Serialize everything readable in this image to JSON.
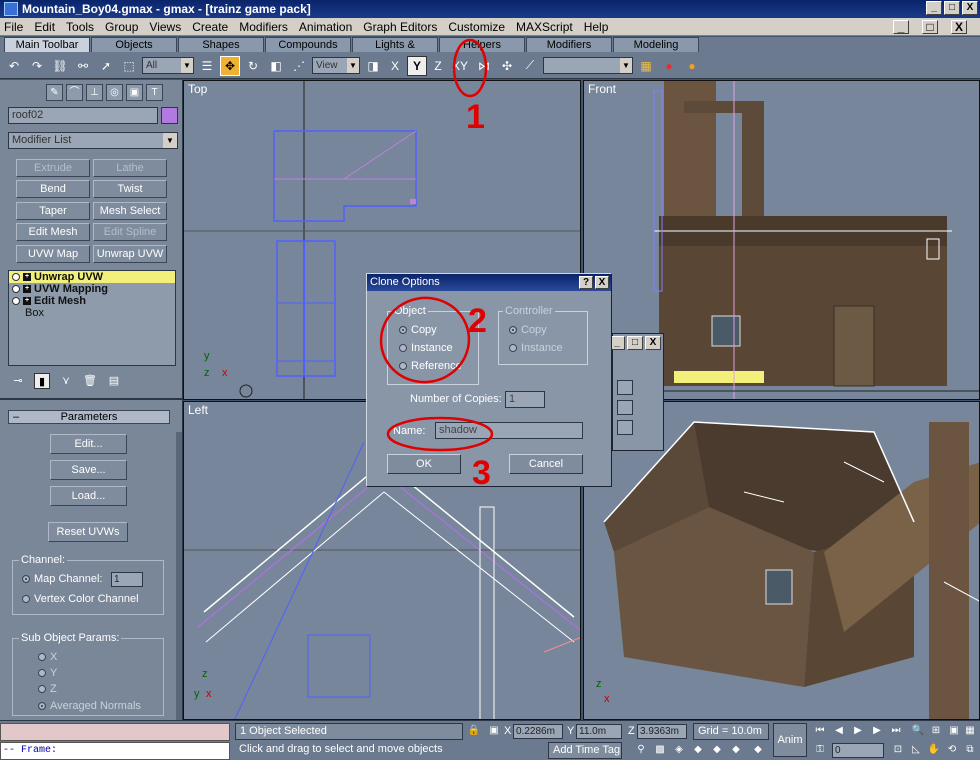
{
  "window": {
    "title": "Mountain_Boy04.gmax - gmax - [trainz game pack]",
    "min": "_",
    "max": "□",
    "close": "X"
  },
  "menu": [
    "File",
    "Edit",
    "Tools",
    "Group",
    "Views",
    "Create",
    "Modifiers",
    "Animation",
    "Graph Editors",
    "Customize",
    "MAXScript",
    "Help"
  ],
  "tabs": [
    "Main Toolbar",
    "Objects",
    "Shapes",
    "Compounds",
    "Lights & Cameras",
    "Helpers",
    "Modifiers",
    "Modeling"
  ],
  "toolbar": {
    "filter": "All",
    "refcoord": "View"
  },
  "left": {
    "object_name": "roof02",
    "modifier_list": "Modifier List",
    "mod_buttons": [
      "Extrude",
      "Lathe",
      "Bend",
      "Twist",
      "Taper",
      "Mesh Select",
      "Edit Mesh",
      "Edit Spline",
      "UVW Map",
      "Unwrap UVW"
    ],
    "stack": [
      "Unwrap UVW",
      "UVW Mapping",
      "Edit Mesh",
      "Box"
    ],
    "params_title": "Parameters",
    "params_buttons": [
      "Edit...",
      "Save...",
      "Load...",
      "Reset UVWs"
    ],
    "channel_label": "Channel:",
    "map_channel": "Map Channel:",
    "map_channel_val": "1",
    "vertex_color": "Vertex Color Channel",
    "subobj_label": "Sub Object Params:",
    "sub_x": "X",
    "sub_y": "Y",
    "sub_z": "Z",
    "avg_normals": "Averaged Normals"
  },
  "viewports": {
    "top": "Top",
    "front": "Front",
    "left": "Left"
  },
  "dialog": {
    "title": "Clone Options",
    "help": "?",
    "close": "X",
    "object_group": "Object",
    "copy": "Copy",
    "instance": "Instance",
    "reference": "Reference",
    "controller_group": "Controller",
    "c_copy": "Copy",
    "c_instance": "Instance",
    "num_copies_label": "Number of Copies:",
    "num_copies": "1",
    "name_label": "Name:",
    "name_value": "shadow",
    "ok": "OK",
    "cancel": "Cancel"
  },
  "annotations": [
    "1",
    "2",
    "3"
  ],
  "status": {
    "listener": "-- Frame:",
    "selected": "1 Object Selected",
    "prompt": "Click and drag to select and move objects",
    "x_val": "0.2286m",
    "y_val": "11.0m",
    "z_val": "3.9363m",
    "grid": "Grid = 10.0m",
    "add_time_tag": "Add Time Tag",
    "anim": "Anim",
    "frame": "0",
    "x_lbl": "X",
    "y_lbl": "Y",
    "z_lbl": "Z"
  },
  "colors": {
    "annotation": "#e00000",
    "viewport_bg": "#77869a",
    "selection": "#f2f07a",
    "active_tool": "#f0b030"
  }
}
